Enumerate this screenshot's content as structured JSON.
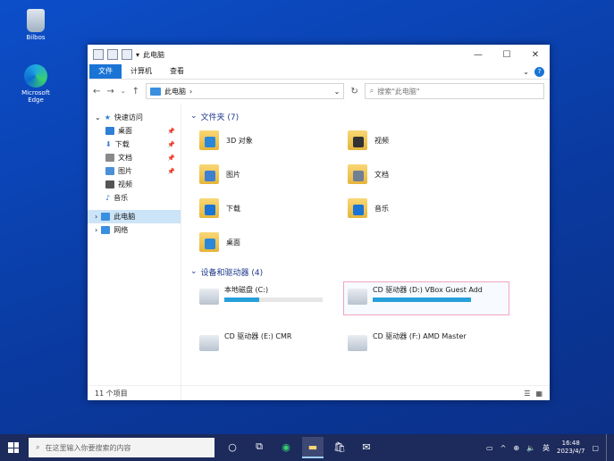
{
  "desktop": {
    "icons": [
      {
        "label": "Bilbos"
      },
      {
        "label": "Microsoft Edge"
      }
    ]
  },
  "window": {
    "title": "此电脑",
    "ribbon_tabs": [
      "文件",
      "计算机",
      "查看"
    ],
    "address": "此电脑",
    "search_placeholder": "搜索\"此电脑\"",
    "nav": {
      "quick_access": "快速访问",
      "items": [
        {
          "label": "桌面",
          "color": "#2f7fd6"
        },
        {
          "label": "下载",
          "color": "#2f7fd6"
        },
        {
          "label": "文档",
          "color": "#8a8a8a"
        },
        {
          "label": "图片",
          "color": "#4a90d9"
        },
        {
          "label": "视频",
          "color": "#555555"
        },
        {
          "label": "音乐",
          "color": "#1a74d6"
        }
      ],
      "this_pc": "此电脑",
      "network": "网络"
    },
    "folders_header": "文件夹 (7)",
    "folders": [
      {
        "label": "3D 对象",
        "badge": "#2b88d8"
      },
      {
        "label": "视频",
        "badge": "#333333"
      },
      {
        "label": "图片",
        "badge": "#3d7fd1"
      },
      {
        "label": "文档",
        "badge": "#6f7f94"
      },
      {
        "label": "下载",
        "badge": "#1a74d6"
      },
      {
        "label": "音乐",
        "badge": "#1a74d6"
      },
      {
        "label": "桌面",
        "badge": "#2b88d8"
      }
    ],
    "drives_header": "设备和驱动器 (4)",
    "drives": [
      {
        "label": "本地磁盘 (C:)",
        "free": "",
        "fill": 0.35
      },
      {
        "label": "CD 驱动器 (D:) VBox Guest Add",
        "free": "",
        "fill": 1.0
      },
      {
        "label": "CD 驱动器 (E:) CMR",
        "free": "",
        "fill": 0
      },
      {
        "label": "CD 驱动器 (F:) AMD Master",
        "free": "",
        "fill": 0
      }
    ],
    "status_left": "11 个项目"
  },
  "taskbar": {
    "search_placeholder": "在这里输入你要搜索的内容",
    "ime": "英",
    "time": "16:48",
    "date": "2023/4/7"
  }
}
